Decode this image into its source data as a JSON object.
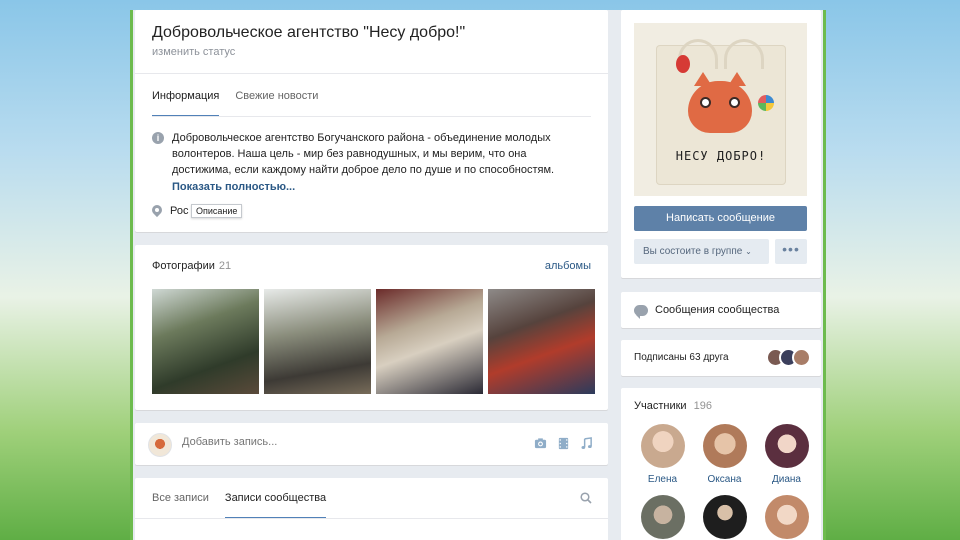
{
  "group": {
    "title": "Добровольческое агентство \"Несу добро!\"",
    "status_placeholder": "изменить статус"
  },
  "header_tabs": [
    {
      "label": "Информация",
      "active": true
    },
    {
      "label": "Свежие новости",
      "active": false
    }
  ],
  "info": {
    "description": "Добровольческое агентство Богучанского района - объединение молодых волонтеров. Наша цель - мир без равнодушных, и мы верим, что она достижима, если каждому найти доброе дело по душе и по способностям.",
    "show_more": "Показать полностью...",
    "location": "Рос",
    "tooltip": "Описание"
  },
  "photos": {
    "title": "Фотографии",
    "count": "21",
    "albums_link": "альбомы"
  },
  "composer": {
    "placeholder": "Добавить запись..."
  },
  "wall_tabs": [
    {
      "label": "Все записи",
      "active": false
    },
    {
      "label": "Записи сообщества",
      "active": true
    }
  ],
  "sidebar": {
    "cover_text": "НЕСУ ДОБРО!",
    "write_message": "Написать сообщение",
    "membership": "Вы состоите в группе",
    "more_button": "•••",
    "community_messages": "Сообщения сообщества",
    "friends_subscribed": "Подписаны 63 друга",
    "members_title": "Участники",
    "members_count": "196",
    "members": [
      {
        "name": "Елена",
        "color": "#c9a98f"
      },
      {
        "name": "Оксана",
        "color": "#b07a5a"
      },
      {
        "name": "Диана",
        "color": "#5b2f3f"
      },
      {
        "name": "",
        "color": "#6b6f63"
      },
      {
        "name": "",
        "color": "#1e1e1e"
      },
      {
        "name": "",
        "color": "#c28a6a"
      }
    ]
  },
  "colors": {
    "accent": "#5181b8",
    "link": "#2a5885",
    "primary_button": "#5e81a8"
  }
}
